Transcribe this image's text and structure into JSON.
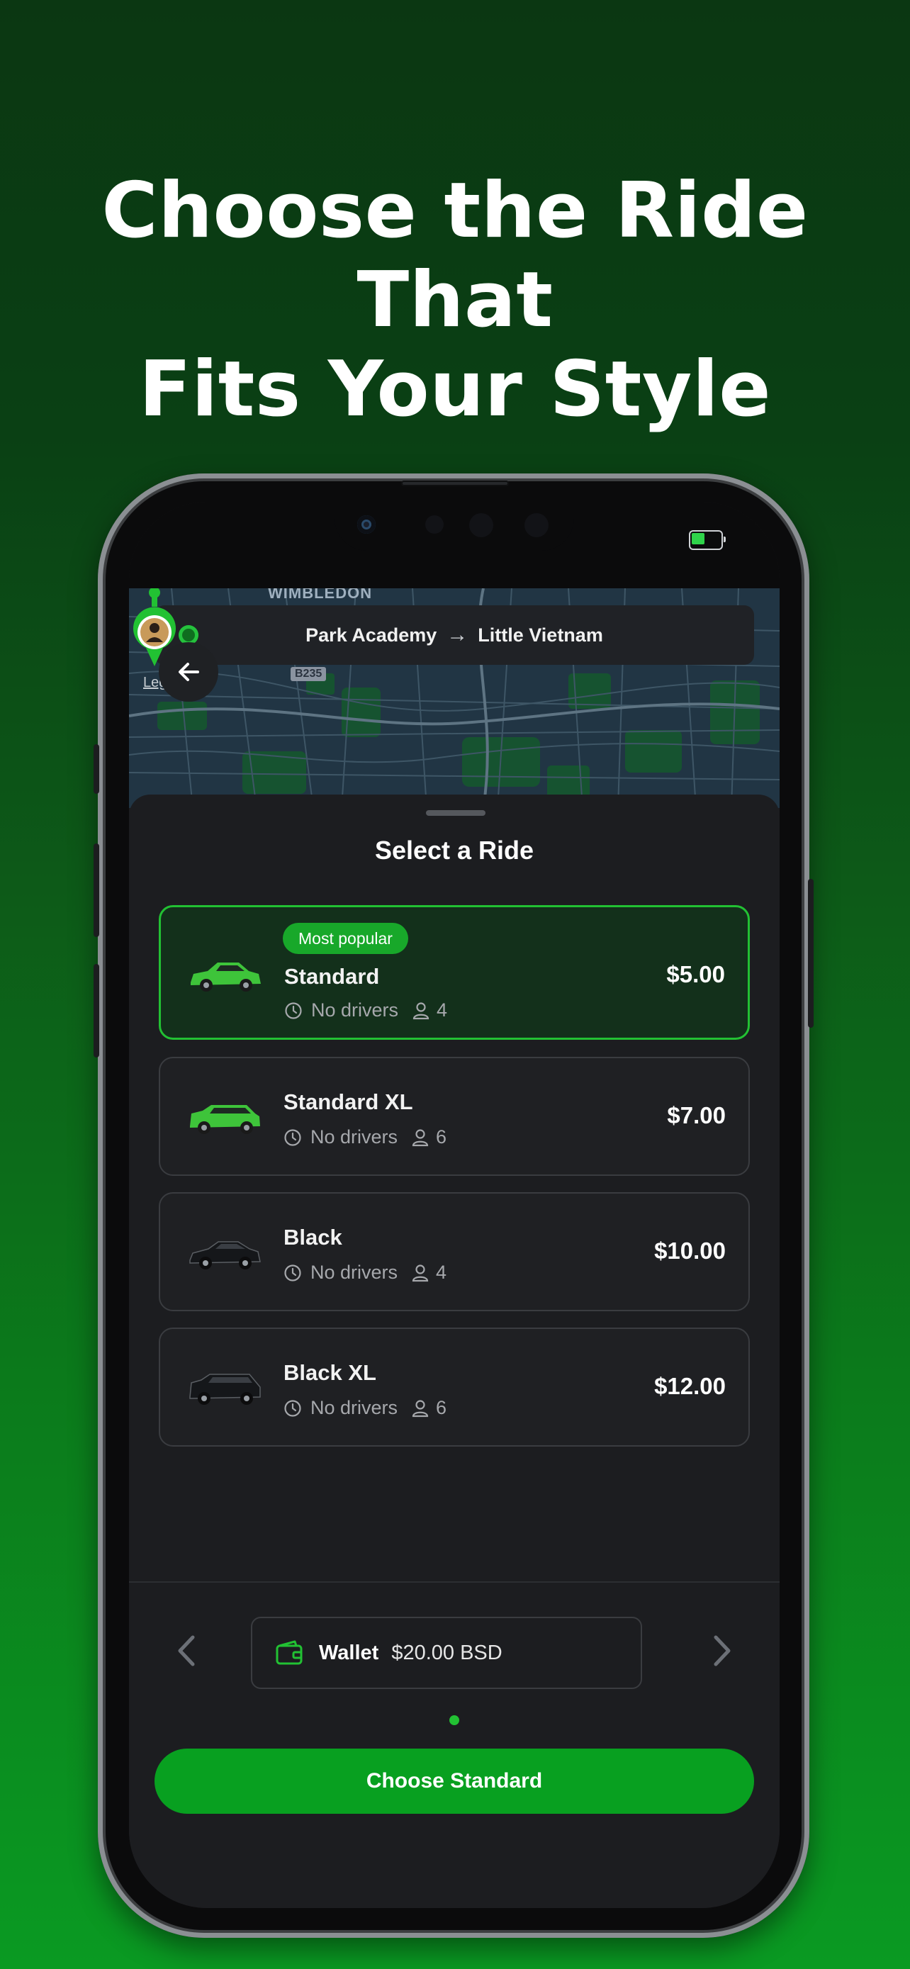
{
  "headline": {
    "line1": "Choose the Ride That",
    "line2": "Fits Your Style"
  },
  "map": {
    "area_label": "WIMBLEDON",
    "road_tag": "B235",
    "legal_label": "Legal",
    "route": {
      "from": "Park Academy",
      "to": "Little Vietnam"
    }
  },
  "sheet": {
    "title": "Select a Ride",
    "rides": [
      {
        "badge": "Most popular",
        "name": "Standard",
        "availability": "No drivers",
        "seats": "4",
        "price": "$5.00",
        "car_color": "#3ec43a",
        "selected": true
      },
      {
        "name": "Standard XL",
        "availability": "No drivers",
        "seats": "6",
        "price": "$7.00",
        "car_color": "#3ec43a",
        "selected": false
      },
      {
        "name": "Black",
        "availability": "No drivers",
        "seats": "4",
        "price": "$10.00",
        "car_color": "#15171a",
        "selected": false
      },
      {
        "name": "Black XL",
        "availability": "No drivers",
        "seats": "6",
        "price": "$12.00",
        "car_color": "#15171a",
        "selected": false
      }
    ],
    "payment": {
      "label": "Wallet",
      "amount": "$20.00 BSD"
    },
    "cta_label": "Choose Standard"
  },
  "colors": {
    "accent": "#22c133",
    "button": "#08a020",
    "sheet_bg": "#1c1d20"
  },
  "icons": [
    "back-arrow-icon",
    "clock-icon",
    "person-icon",
    "wallet-icon",
    "chevron-left-icon",
    "chevron-right-icon",
    "location-pin-icon"
  ]
}
